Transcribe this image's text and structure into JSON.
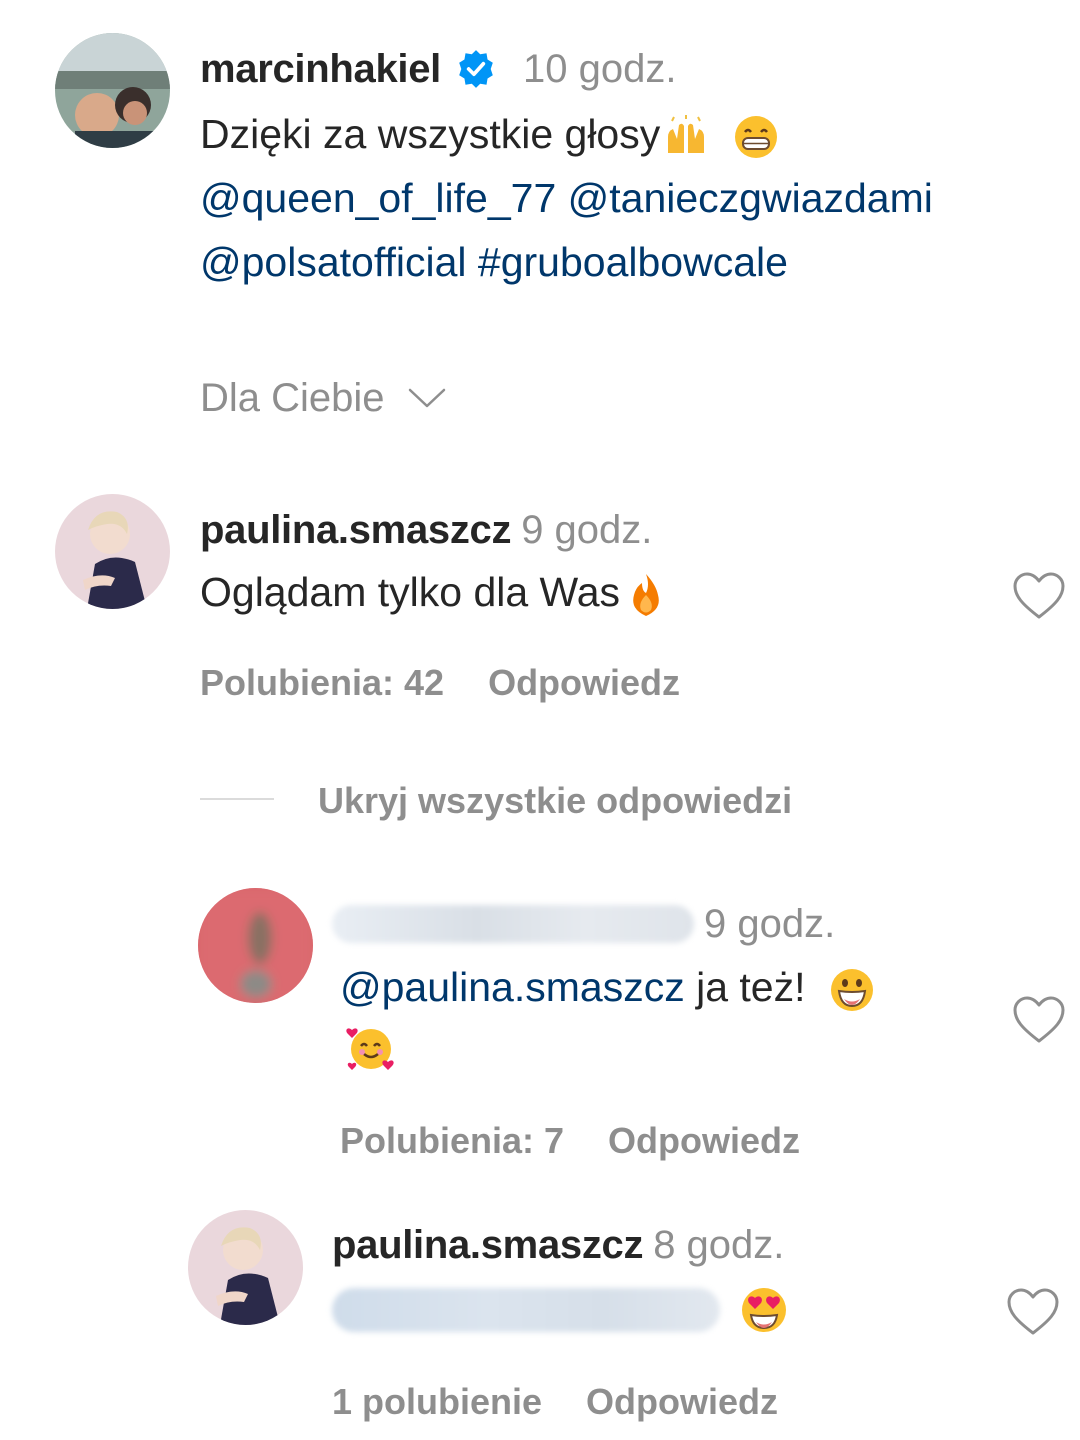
{
  "post": {
    "username": "marcinhakiel",
    "time": "10 godz.",
    "caption": "Dzięki za wszystkie głosy",
    "mentions_line1": [
      "@queen_of_life_77",
      "@tanieczgwiazdami"
    ],
    "mention_line2": "@polsatofficial",
    "hashtag": "#gruboalbowcale"
  },
  "sort": {
    "label": "Dla Ciebie"
  },
  "comments": [
    {
      "username": "paulina.smaszcz",
      "time": "9 godz.",
      "text": "Oglądam tylko dla Was",
      "likes": "Polubienia: 42",
      "reply": "Odpowiedz"
    }
  ],
  "replies_toggle": "Ukryj wszystkie odpowiedzi",
  "replies": [
    {
      "time": "9 godz.",
      "mention": "@paulina.smaszcz",
      "text": "ja też!",
      "likes": "Polubienia: 7",
      "reply": "Odpowiedz"
    },
    {
      "username": "paulina.smaszcz",
      "time": "8 godz.",
      "likes": "1 polubienie",
      "reply": "Odpowiedz"
    }
  ],
  "icons": {
    "verified": "verified-badge-icon",
    "chevron": "chevron-down-icon",
    "heart": "heart-outline-icon"
  },
  "colors": {
    "link": "#00376b",
    "verified": "#0095f6",
    "muted": "#8e8e8e"
  }
}
